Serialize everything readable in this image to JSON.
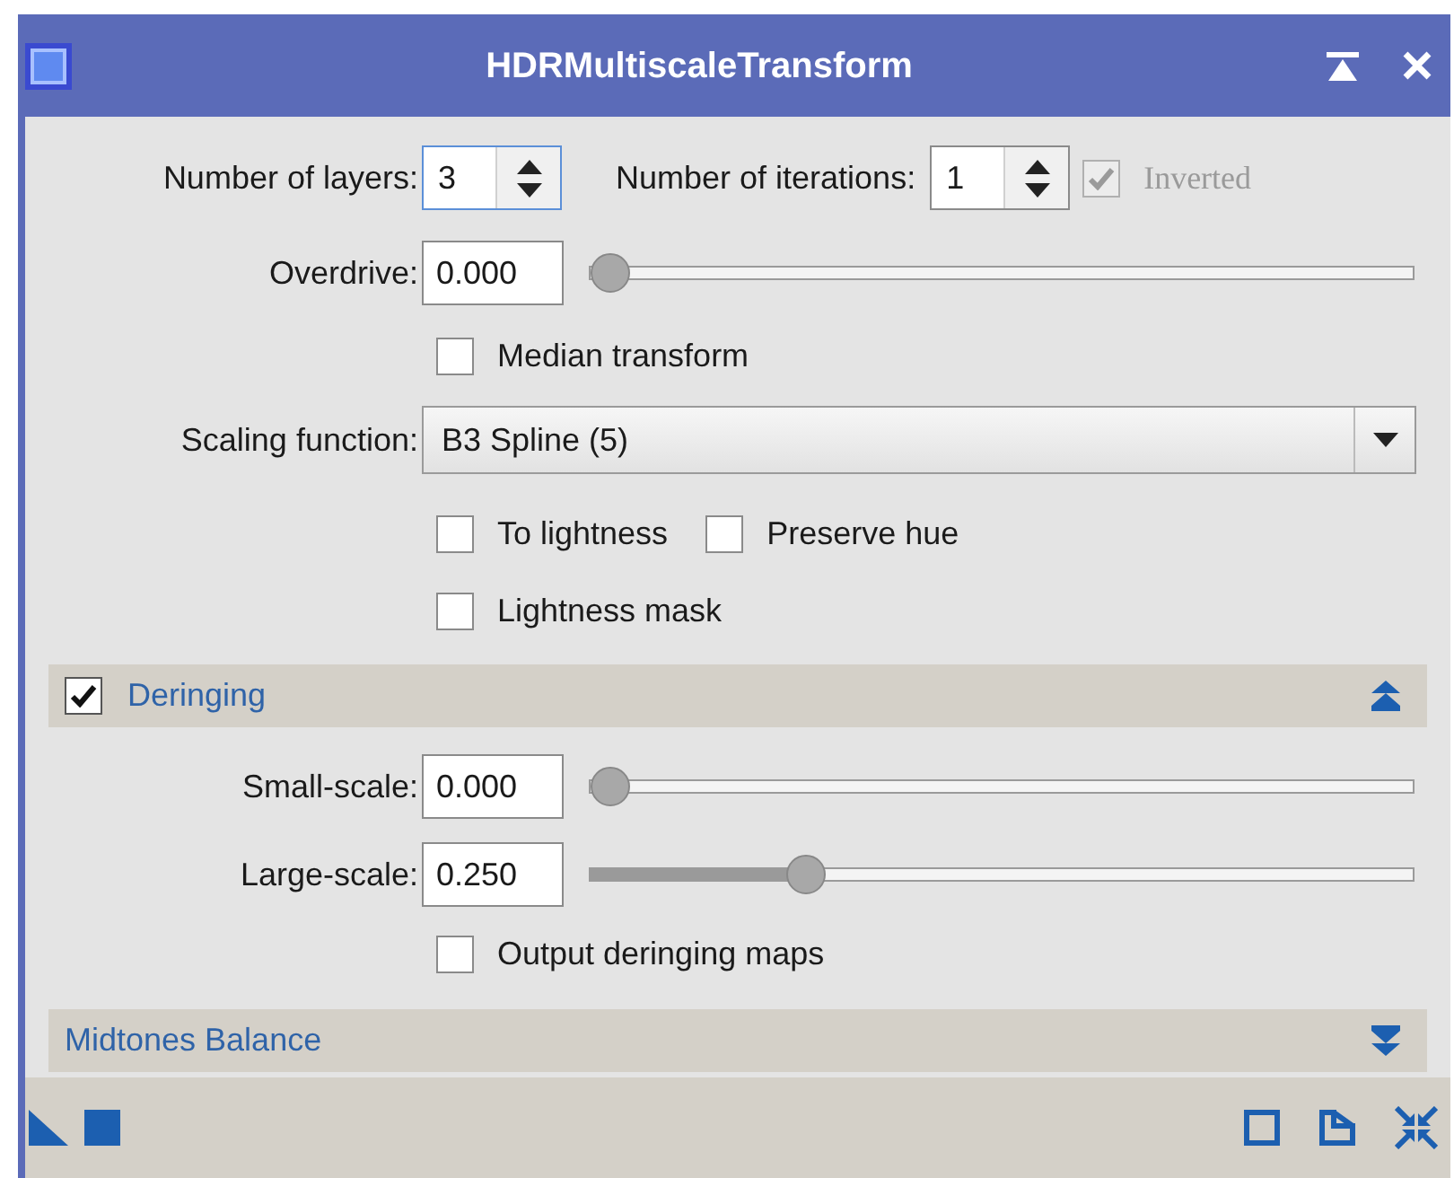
{
  "window": {
    "title": "HDRMultiscaleTransform"
  },
  "layers": {
    "label": "Number of layers:",
    "value": "3"
  },
  "iterations": {
    "label": "Number of iterations:",
    "value": "1"
  },
  "inverted": {
    "label": "Inverted",
    "checked": true,
    "disabled": true
  },
  "overdrive": {
    "label": "Overdrive:",
    "value": "0.000",
    "level": 0
  },
  "median_transform": {
    "label": "Median transform",
    "checked": false
  },
  "scaling_function": {
    "label": "Scaling function:",
    "value": "B3 Spline (5)"
  },
  "to_lightness": {
    "label": "To lightness",
    "checked": false
  },
  "preserve_hue": {
    "label": "Preserve hue",
    "checked": false
  },
  "lightness_mask": {
    "label": "Lightness mask",
    "checked": false
  },
  "deringing": {
    "title": "Deringing",
    "checked": true,
    "expanded": true,
    "small_scale": {
      "label": "Small-scale:",
      "value": "0.000",
      "level": 0
    },
    "large_scale": {
      "label": "Large-scale:",
      "value": "0.250",
      "level": 0.25
    },
    "output_maps": {
      "label": "Output deringing maps",
      "checked": false
    }
  },
  "midtones_balance": {
    "title": "Midtones Balance",
    "expanded": false
  }
}
